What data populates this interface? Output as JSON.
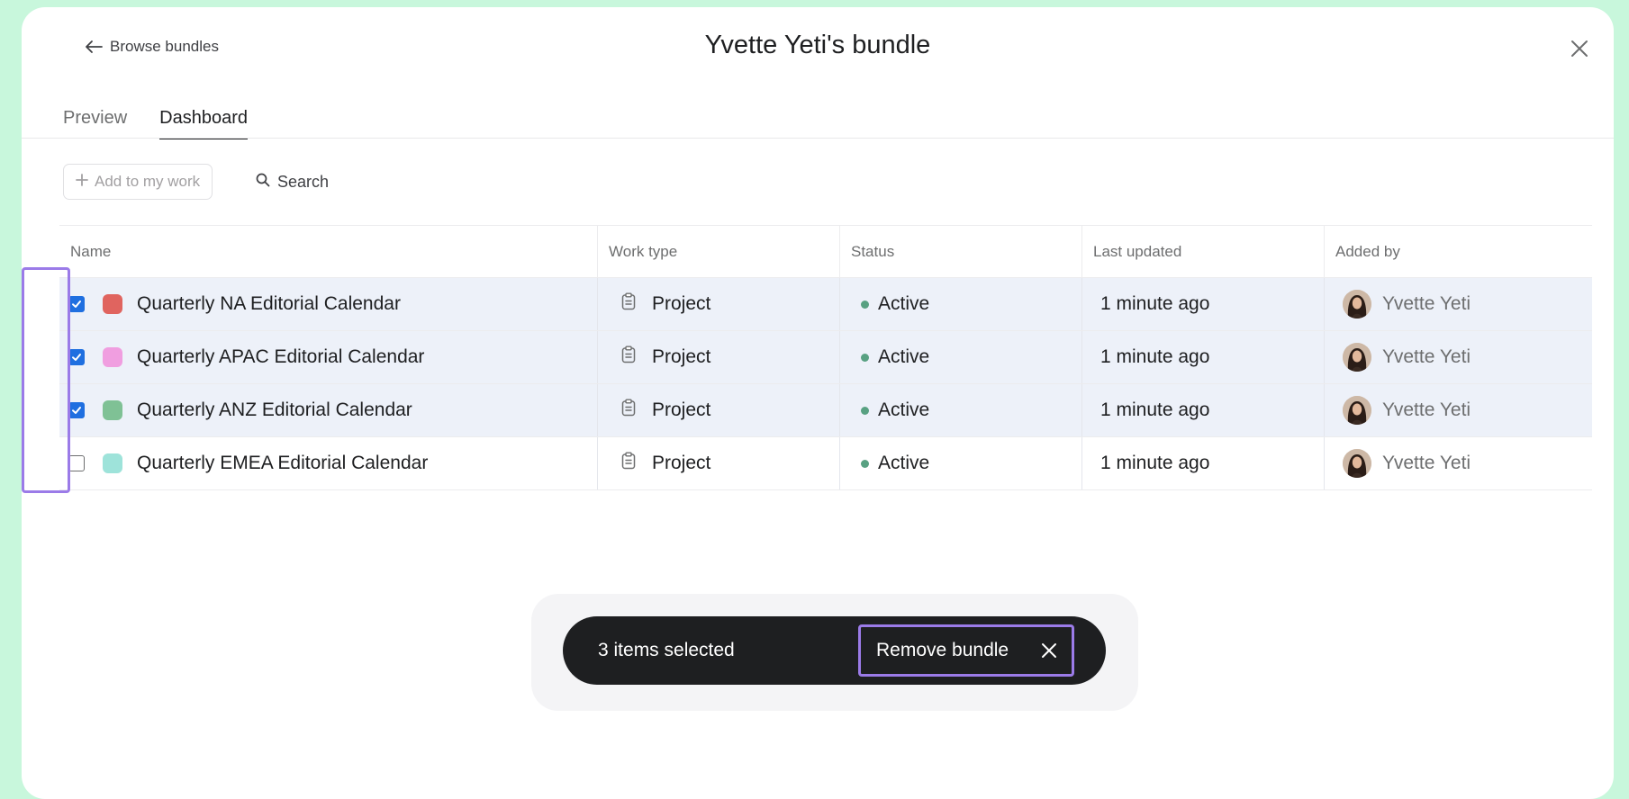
{
  "header": {
    "back_label": "Browse bundles",
    "title": "Yvette Yeti's bundle"
  },
  "tabs": [
    {
      "label": "Preview",
      "active": false
    },
    {
      "label": "Dashboard",
      "active": true
    }
  ],
  "toolbar": {
    "add_label": "Add to my work",
    "search_label": "Search"
  },
  "table": {
    "columns": [
      "Name",
      "Work type",
      "Status",
      "Last updated",
      "Added by"
    ],
    "rows": [
      {
        "checked": true,
        "color": "#e0645f",
        "name": "Quarterly NA Editorial Calendar",
        "work_type": "Project",
        "status": "Active",
        "updated": "1 minute ago",
        "added_by": "Yvette Yeti"
      },
      {
        "checked": true,
        "color": "#f09ee0",
        "name": "Quarterly APAC Editorial Calendar",
        "work_type": "Project",
        "status": "Active",
        "updated": "1 minute ago",
        "added_by": "Yvette Yeti"
      },
      {
        "checked": true,
        "color": "#7fc195",
        "name": "Quarterly ANZ Editorial Calendar",
        "work_type": "Project",
        "status": "Active",
        "updated": "1 minute ago",
        "added_by": "Yvette Yeti"
      },
      {
        "checked": false,
        "color": "#9ee3da",
        "name": "Quarterly EMEA Editorial Calendar",
        "work_type": "Project",
        "status": "Active",
        "updated": "1 minute ago",
        "added_by": "Yvette Yeti"
      }
    ]
  },
  "actionbar": {
    "selected_text": "3 items selected",
    "remove_label": "Remove bundle"
  },
  "colors": {
    "background": "#c8f7dc",
    "checkbox_checked": "#1f6fe0",
    "status_active": "#58a182",
    "highlight": "#9b7be8",
    "actionbar": "#1e1f21"
  }
}
